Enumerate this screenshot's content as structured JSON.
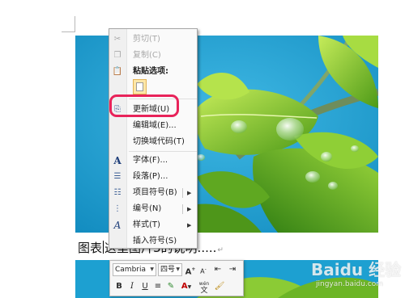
{
  "context_menu": {
    "cut": "剪切(T)",
    "copy": "复制(C)",
    "paste_options": "粘贴选项:",
    "update_field": "更新域(U)",
    "edit_field": "编辑域(E)...",
    "toggle_field_codes": "切换域代码(T)",
    "font": "字体(F)...",
    "paragraph": "段落(P)...",
    "bullets": "项目符号(B)",
    "numbering": "编号(N)",
    "styles": "样式(T)",
    "insert_symbol": "插入符号(S)"
  },
  "document": {
    "caption_prefix": "图表",
    "caption_text": "这里图片3的说明.....",
    "return_mark": "↵"
  },
  "mini_toolbar": {
    "font_name": "Cambria",
    "font_size": "四号",
    "grow_font": "A",
    "shrink_font": "A",
    "bold": "B",
    "italic": "I",
    "underline": "U",
    "font_color": "A",
    "phonetic": "wén",
    "phonetic_char": "文"
  },
  "watermark": {
    "logo": "Baidu 经验",
    "url": "jingyan.baidu.com"
  },
  "colors": {
    "highlight": "#e8235a",
    "photo_sky": "#1fa3d4",
    "leaf": "#7cc32a"
  }
}
